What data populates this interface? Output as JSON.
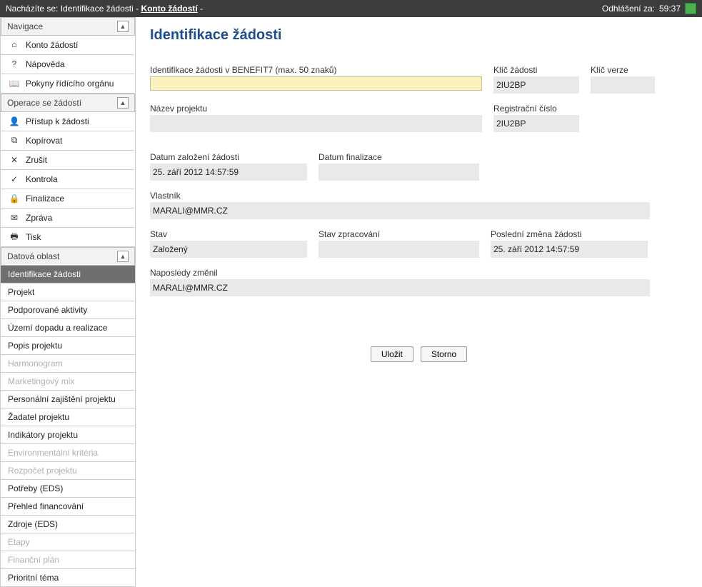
{
  "topbar": {
    "prefix": "Nacházíte se: Identifikace žádosti - ",
    "link": "Konto žádostí",
    "suffix": " -",
    "logout_label": "Odhlášení za:",
    "logout_time": "59:37"
  },
  "sidebar": {
    "nav_header": "Navigace",
    "nav_items": [
      {
        "icon": "⌂",
        "label": "Konto žádostí"
      },
      {
        "icon": "?",
        "label": "Nápověda"
      },
      {
        "icon": "📖",
        "label": "Pokyny řídícího orgánu"
      }
    ],
    "ops_header": "Operace se žádostí",
    "ops_items": [
      {
        "icon": "👤",
        "label": "Přístup k žádosti"
      },
      {
        "icon": "⧉",
        "label": "Kopírovat"
      },
      {
        "icon": "✕",
        "label": "Zrušit"
      },
      {
        "icon": "✓",
        "label": "Kontrola"
      },
      {
        "icon": "🔒",
        "label": "Finalizace"
      },
      {
        "icon": "✉",
        "label": "Zpráva"
      },
      {
        "icon": "🖶",
        "label": "Tisk"
      }
    ],
    "data_header": "Datová oblast",
    "data_items": [
      {
        "label": "Identifikace žádosti",
        "active": true
      },
      {
        "label": "Projekt"
      },
      {
        "label": "Podporované aktivity"
      },
      {
        "label": "Území dopadu a realizace"
      },
      {
        "label": "Popis projektu"
      },
      {
        "label": "Harmonogram",
        "disabled": true
      },
      {
        "label": "Marketingový mix",
        "disabled": true
      },
      {
        "label": "Personální zajištění projektu"
      },
      {
        "label": "Žadatel projektu"
      },
      {
        "label": "Indikátory projektu"
      },
      {
        "label": "Environmentální kritéria",
        "disabled": true
      },
      {
        "label": "Rozpočet projektu",
        "disabled": true
      },
      {
        "label": "Potřeby (EDS)"
      },
      {
        "label": "Přehled financování"
      },
      {
        "label": "Zdroje (EDS)"
      },
      {
        "label": "Etapy",
        "disabled": true
      },
      {
        "label": "Finanční plán",
        "disabled": true
      },
      {
        "label": "Prioritní téma"
      }
    ]
  },
  "page": {
    "title": "Identifikace žádosti",
    "fields": {
      "ident_label": "Identifikace žádosti v BENEFIT7 (max. 50 znaků)",
      "ident_value": "",
      "key_label": "Klíč žádosti",
      "key_value": "2IU2BP",
      "ver_label": "Klíč verze",
      "ver_value": "",
      "name_label": "Název projektu",
      "name_value": "",
      "reg_label": "Registrační číslo",
      "reg_value": "2IU2BP",
      "created_label": "Datum založení žádosti",
      "created_value": "25. září 2012 14:57:59",
      "final_label": "Datum finalizace",
      "final_value": "",
      "owner_label": "Vlastník",
      "owner_value": "MARALI@MMR.CZ",
      "state_label": "Stav",
      "state_value": "Založený",
      "proc_label": "Stav zpracování",
      "proc_value": "",
      "last_label": "Poslední změna žádosti",
      "last_value": "25. září 2012 14:57:59",
      "lastby_label": "Naposledy změnil",
      "lastby_value": "MARALI@MMR.CZ"
    },
    "buttons": {
      "save": "Uložit",
      "cancel": "Storno"
    }
  }
}
